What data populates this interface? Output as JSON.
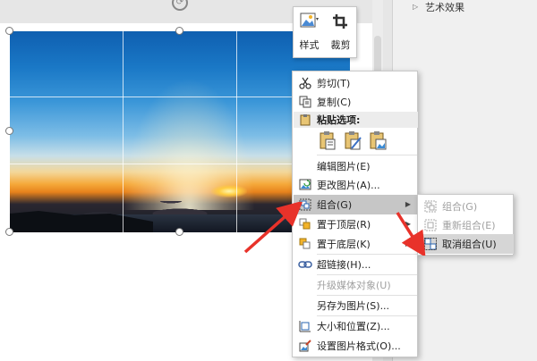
{
  "mini_toolbar": {
    "style_label": "样式",
    "crop_label": "裁剪"
  },
  "right_panel": {
    "art_effects_label": "艺术效果"
  },
  "context_menu": {
    "cut": "剪切(T)",
    "copy": "复制(C)",
    "paste_options": "粘贴选项:",
    "edit_picture": "编辑图片(E)",
    "change_picture": "更改图片(A)...",
    "group": "组合(G)",
    "bring_to_front": "置于顶层(R)",
    "send_to_back": "置于底层(K)",
    "hyperlink": "超链接(H)...",
    "upgrade_media": "升级媒体对象(U)",
    "save_as_picture": "另存为图片(S)...",
    "size_position": "大小和位置(Z)...",
    "format_picture": "设置图片格式(O)..."
  },
  "group_submenu": {
    "group": "组合(G)",
    "regroup": "重新组合(E)",
    "ungroup": "取消组合(U)"
  },
  "colors": {
    "highlight": "#c6c6c6",
    "annotation_arrow": "#e8322a",
    "disabled_text": "#a0a0a0"
  }
}
